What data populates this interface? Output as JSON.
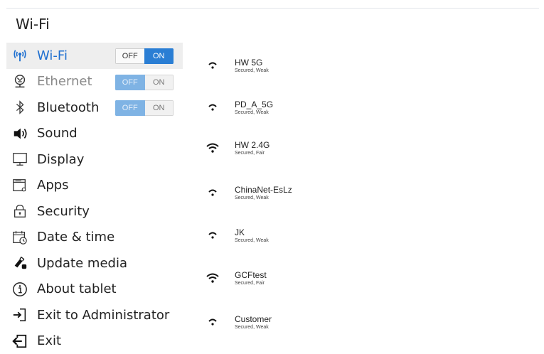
{
  "page": {
    "title": "Wi-Fi"
  },
  "sidebar": {
    "items": [
      {
        "label": "Wi-Fi",
        "icon": "wifi-signal-icon",
        "toggle": {
          "off": "OFF",
          "on": "ON",
          "state": "on"
        }
      },
      {
        "label": "Ethernet",
        "icon": "ethernet-icon",
        "toggle": {
          "off": "OFF",
          "on": "ON",
          "state": "disabled"
        }
      },
      {
        "label": "Bluetooth",
        "icon": "bluetooth-icon",
        "toggle": {
          "off": "OFF",
          "on": "ON",
          "state": "disabled"
        }
      },
      {
        "label": "Sound",
        "icon": "speaker-icon"
      },
      {
        "label": "Display",
        "icon": "monitor-icon"
      },
      {
        "label": "Apps",
        "icon": "apps-window-icon"
      },
      {
        "label": "Security",
        "icon": "lock-icon"
      },
      {
        "label": "Date & time",
        "icon": "calendar-clock-icon"
      },
      {
        "label": "Update media",
        "icon": "usb-drive-icon"
      },
      {
        "label": "About tablet",
        "icon": "info-icon"
      },
      {
        "label": "Exit to Administrator",
        "icon": "exit-to-admin-icon"
      },
      {
        "label": "Exit",
        "icon": "exit-icon"
      }
    ]
  },
  "networks": [
    {
      "name": "HW 5G",
      "status": "Secured, Weak",
      "strength": "weak"
    },
    {
      "name": "PD_A_5G",
      "status": "Secured, Weak",
      "strength": "weak"
    },
    {
      "name": "HW 2.4G",
      "status": "Secured, Fair",
      "strength": "fair"
    },
    {
      "name": "ChinaNet-EsLz",
      "status": "Secured, Weak",
      "strength": "weak"
    },
    {
      "name": "JK",
      "status": "Secured, Weak",
      "strength": "weak"
    },
    {
      "name": "GCFtest",
      "status": "Secured, Fair",
      "strength": "fair"
    },
    {
      "name": "Customer",
      "status": "Secured, Weak",
      "strength": "weak"
    }
  ],
  "colors": {
    "accent": "#1e6fd0",
    "toggle_on": "#2a7ed4",
    "toggle_disabled": "#7fb3e4",
    "active_row": "#eeeeee"
  }
}
